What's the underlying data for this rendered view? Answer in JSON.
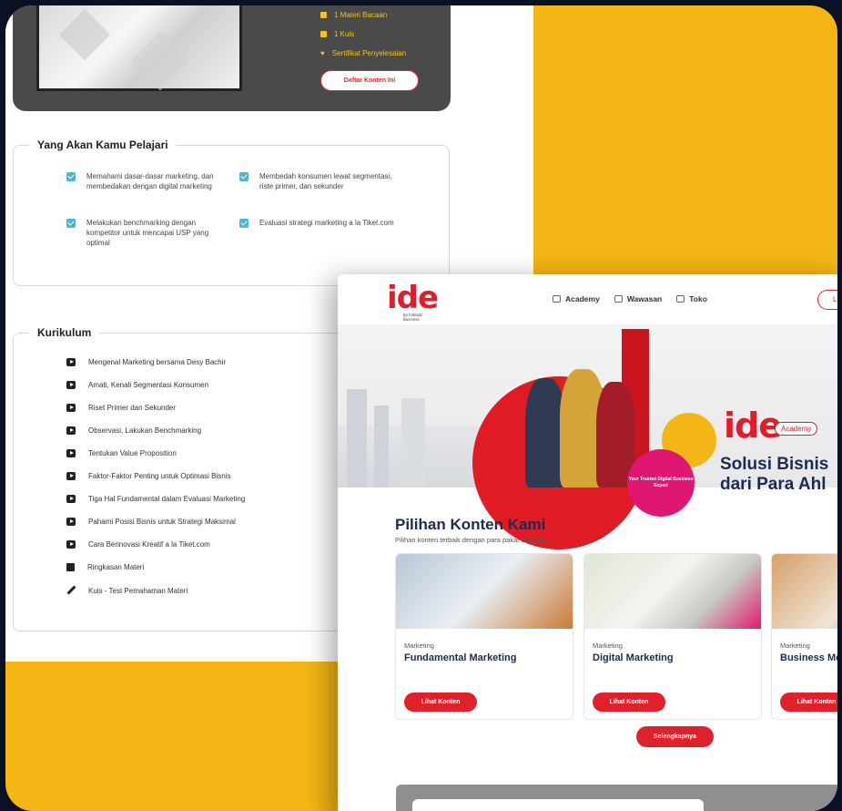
{
  "back_page": {
    "course_meta": [
      {
        "icon": "book-icon",
        "label": "1 Materi Bacaan"
      },
      {
        "icon": "quiz-icon",
        "label": "1 Kuis"
      },
      {
        "icon": "trophy-icon",
        "label": "Sertifikat Penyelesaian"
      }
    ],
    "register_button": "Daftar Konten Ini",
    "learn_title": "Yang Akan Kamu Pelajari",
    "learn_items": [
      "Memahami dasar-dasar marketing, dan membedakan dengan digital marketing",
      "Membedah konsumen lewat segmentasi, riste primer, dan sekunder",
      "Melakukan benchmarking dengan kompetitor untuk mencapai USP yang optimal",
      "Evaluasi strategi marketing a la Tiket.com"
    ],
    "curriculum_title": "Kurikulum",
    "curriculum_items": [
      {
        "icon": "play-icon",
        "label": "Mengenal Marketing bersama Desy Bachir"
      },
      {
        "icon": "play-icon",
        "label": "Amati, Kenali Segmentasi Konsumen"
      },
      {
        "icon": "play-icon",
        "label": "Riset Primer dan Sekunder"
      },
      {
        "icon": "play-icon",
        "label": "Observasi, Lakukan Benchmarking"
      },
      {
        "icon": "play-icon",
        "label": "Tentukan Value Proposition"
      },
      {
        "icon": "play-icon",
        "label": "Faktor-Faktor Penting untuk Optimasi Bisnis"
      },
      {
        "icon": "play-icon",
        "label": "Tiga Hal Fundamental dalam Evaluasi Marketing"
      },
      {
        "icon": "play-icon",
        "label": "Pahami Posisi Bisnis untuk Strategi Maksimal"
      },
      {
        "icon": "play-icon",
        "label": "Cara Berinovasi Kreatif a la Tiket.com"
      },
      {
        "icon": "book-icon",
        "label": "Ringkasan Materi"
      },
      {
        "icon": "pencil-icon",
        "label": "Kuis - Test Pemahaman Materi"
      }
    ]
  },
  "front_page": {
    "logo": "ide",
    "logo_sub": "by Indosat Business",
    "nav": [
      {
        "icon": "academy-icon",
        "label": "Academy"
      },
      {
        "icon": "wawasan-icon",
        "label": "Wawasan"
      },
      {
        "icon": "toko-icon",
        "label": "Toko"
      }
    ],
    "login_label": "Log",
    "banner": {
      "badge_text": "Your Trusted Digital Business Expert",
      "academy_label": "Academy",
      "headline_1": "Solusi Bisnis",
      "headline_2": "dari Para Ahl"
    },
    "section_title": "Pilihan Konten Kami",
    "section_subtitle": "Pilihan konten terbaik dengan para pakar dan ahli",
    "cards": [
      {
        "category": "Marketing",
        "title": "Fundamental Marketing",
        "button": "Lihat Konten"
      },
      {
        "category": "Marketing",
        "title": "Digital Marketing",
        "button": "Lihat Konten"
      },
      {
        "category": "Marketing",
        "title": "Business Mod",
        "button": "Lihat Konten"
      }
    ],
    "more_button": "Selengkapnya"
  },
  "colors": {
    "accent": "#e0202a",
    "brand_yellow": "#f4b614",
    "navy": "#1d2b4f",
    "check": "#4fb5d8"
  }
}
